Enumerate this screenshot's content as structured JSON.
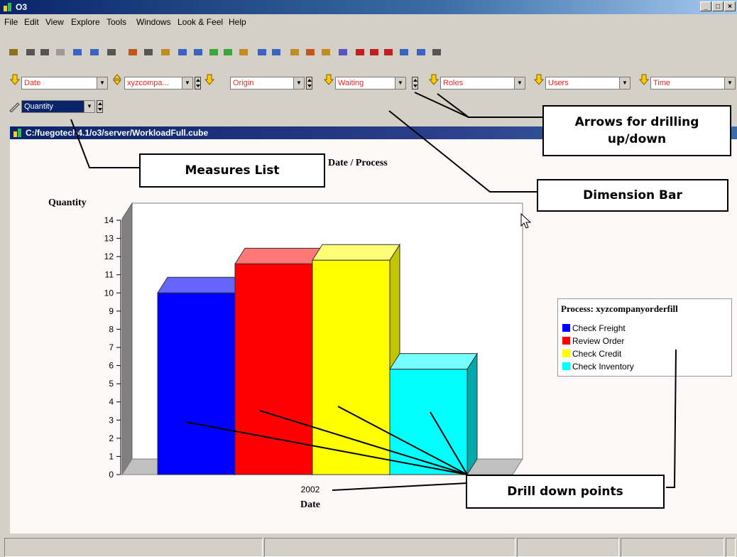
{
  "window": {
    "title": "O3",
    "min": "_",
    "max": "□",
    "close": "×"
  },
  "menu": [
    {
      "label": "File"
    },
    {
      "label": "Edit"
    },
    {
      "label": "View"
    },
    {
      "label": "Explore"
    },
    {
      "label": "Tools"
    },
    {
      "label": "Windows"
    },
    {
      "label": "Look & Feel"
    },
    {
      "label": "Help"
    }
  ],
  "toolbar_icons": [
    "open-icon",
    "save-icon",
    "print-icon",
    "copy-icon",
    "back-icon",
    "forward-icon",
    "tree-icon",
    "filter-icon",
    "table-icon",
    "bar-chart-icon",
    "stacked-bar-icon",
    "line-icon",
    "check-icon",
    "check-outline-icon",
    "grid-icon",
    "line-chart-icon",
    "scatter-icon",
    "bar-3d-icon",
    "bar-3d-stacked-icon",
    "bar-3d-percent-icon",
    "pie-icon",
    "area-icon",
    "area2-icon",
    "radar-icon",
    "combo-icon",
    "hbar-icon",
    "list-icon"
  ],
  "dimensions": [
    {
      "value": "Date"
    },
    {
      "value": "xyzcompa..."
    },
    {
      "value": "Origin"
    },
    {
      "value": "Waiting"
    },
    {
      "value": "Roles"
    },
    {
      "value": "Users"
    },
    {
      "value": "Time"
    }
  ],
  "measure": {
    "value": "Quantity"
  },
  "path": "C:/fuegotech4.1/o3/server/WorkloadFull.cube",
  "callouts": {
    "arrows": "Arrows for drilling up/down",
    "measures": "Measures List",
    "dimension_bar": "Dimension Bar",
    "drill_down": "Drill down points"
  },
  "chart_data": {
    "type": "bar",
    "title": "Date / Process",
    "ylabel": "Quantity",
    "xlabel": "Date",
    "categories": [
      "2002"
    ],
    "ylim": [
      0,
      14
    ],
    "yticks": [
      0,
      1,
      2,
      3,
      4,
      5,
      6,
      7,
      8,
      9,
      10,
      11,
      12,
      13,
      14
    ],
    "series": [
      {
        "name": "Check Freight",
        "values": [
          10
        ],
        "color": "#0000ff"
      },
      {
        "name": "Review Order",
        "values": [
          11.6
        ],
        "color": "#ff0000"
      },
      {
        "name": "Check Credit",
        "values": [
          11.8
        ],
        "color": "#ffff00"
      },
      {
        "name": "Check Inventory",
        "values": [
          5.8
        ],
        "color": "#00ffff"
      }
    ],
    "legend_title": "Process: xyzcompanyorderfill",
    "legend_position": "right"
  }
}
